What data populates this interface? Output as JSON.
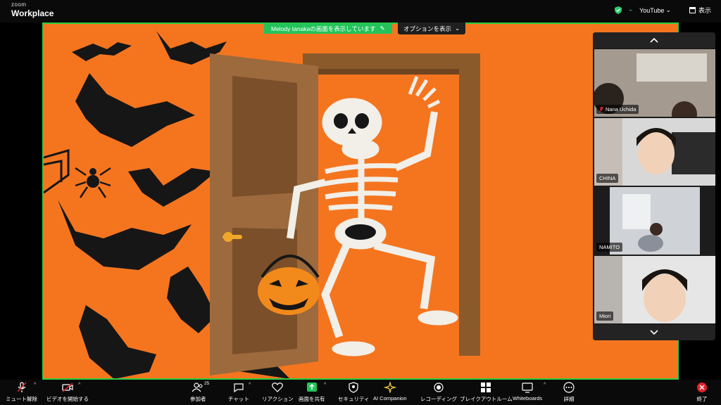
{
  "app": {
    "logo_top": "zoom",
    "logo_bottom": "Workplace"
  },
  "topbar": {
    "youtube": "YouTube",
    "view": "表示"
  },
  "share": {
    "banner": "Melody tanakaの画面を表示しています",
    "options": "オプションを表示"
  },
  "participants": [
    {
      "name": "Nana Uchida",
      "muted": true
    },
    {
      "name": "CHINA",
      "muted": false
    },
    {
      "name": "NAMITO",
      "muted": false
    },
    {
      "name": "Miori",
      "muted": false
    }
  ],
  "toolbar": {
    "mute": "ミュート解除",
    "video": "ビデオを開始する",
    "participants": "参加者",
    "participants_count": "25",
    "chat": "チャット",
    "reactions": "リアクション",
    "share": "画面を共有",
    "security": "セキュリティ",
    "ai": "AI Companion",
    "record": "レコーディング",
    "breakout": "ブレイクアウトルーム",
    "whiteboards": "Whiteboards",
    "more": "詳細",
    "end": "終了"
  },
  "colors": {
    "accent_green": "#22c35a",
    "stage_bg": "#f5751f",
    "end_red": "#e0202a",
    "toolbar_bg": "#0a0a0a"
  }
}
